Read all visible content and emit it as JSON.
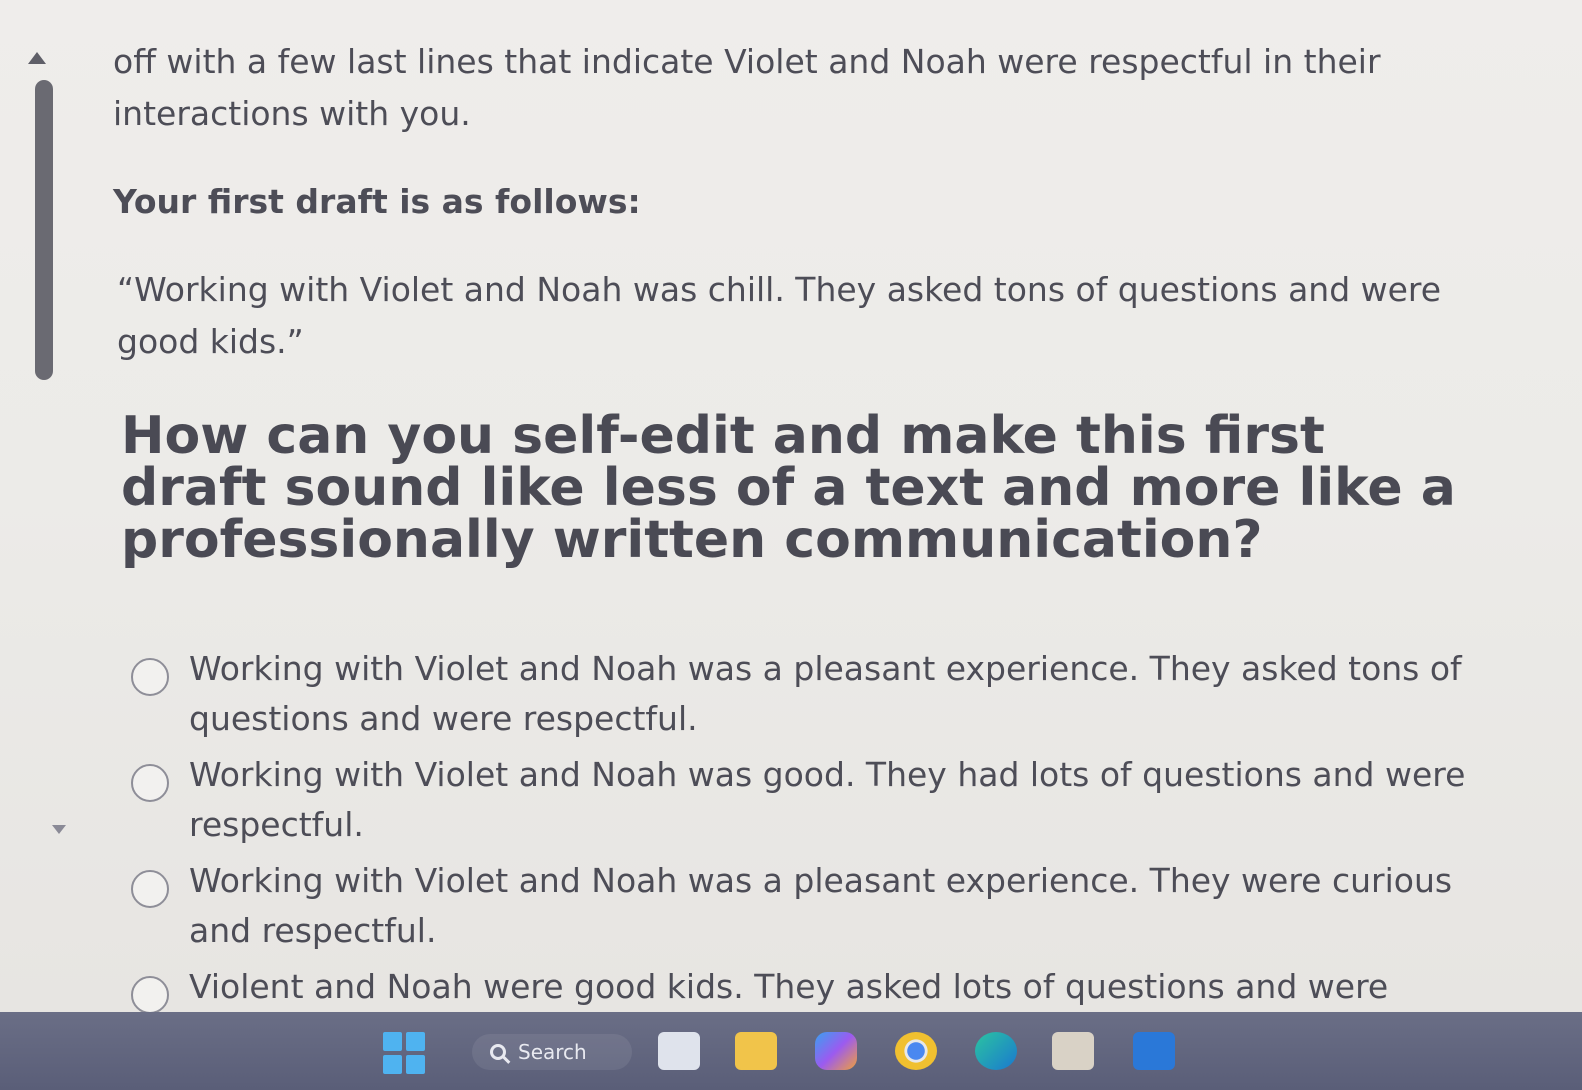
{
  "content": {
    "intro_line1": "off with a few last lines that indicate Violet and Noah were respectful in their",
    "intro_line2": "interactions with you.",
    "draft_label": "Your first draft is as follows:",
    "draft_text": "“Working with Violet and Noah was chill. They asked tons of questions and were good kids.”",
    "question": "How can you self-edit and make this first draft sound like less of a text and more like a professionally written communication?"
  },
  "options": [
    {
      "label": "Working with Violet and Noah was a pleasant experience. They asked tons of questions and were respectful."
    },
    {
      "label": "Working with Violet and Noah was good. They had lots of questions and were respectful."
    },
    {
      "label": "Working with Violet and Noah was a pleasant experience. They were curious and respectful."
    },
    {
      "label": "Violent and Noah were good kids. They asked lots of questions and were"
    }
  ],
  "taskbar": {
    "search_label": "Search",
    "icons": [
      "windows-start-icon",
      "task-view-icon",
      "file-explorer-icon",
      "copilot-icon",
      "chrome-icon",
      "edge-icon",
      "store-icon",
      "outlook-icon"
    ]
  }
}
